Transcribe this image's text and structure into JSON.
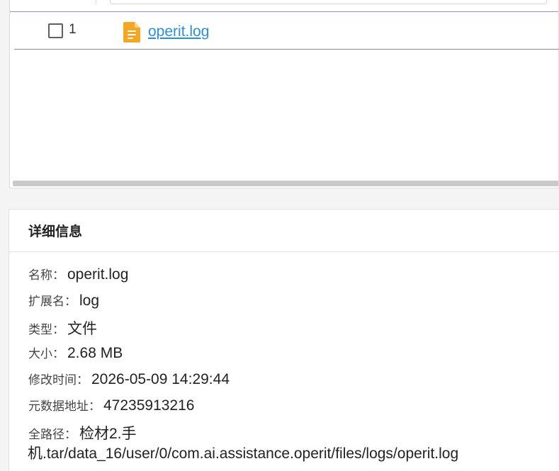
{
  "table": {
    "filter_placeholder": "",
    "rows": [
      {
        "index": "1",
        "checked": false,
        "file_name": "operit.log",
        "icon": "file-document-icon"
      }
    ]
  },
  "details": {
    "title": "详细信息",
    "name_label": "名称：",
    "name_value": "operit.log",
    "ext_label": "扩展名：",
    "ext_value": "log",
    "type_label": "类型：",
    "type_value": "文件",
    "size_label": "大小：",
    "size_value": "2.68 MB",
    "mtime_label": "修改时间：",
    "mtime_value": "2026-05-09 14:29:44",
    "meta_label": "元数据地址：",
    "meta_value": "47235913216",
    "path_label": "全路径：",
    "path_value_line1": "检材2.手",
    "path_value_line2": "机.tar/data_16/user/0/com.ai.assistance.operit/files/logs/operit.log"
  },
  "colors": {
    "link": "#2b8fe0",
    "file_icon": "#f5a623",
    "header_divider": "#8c93d3"
  }
}
